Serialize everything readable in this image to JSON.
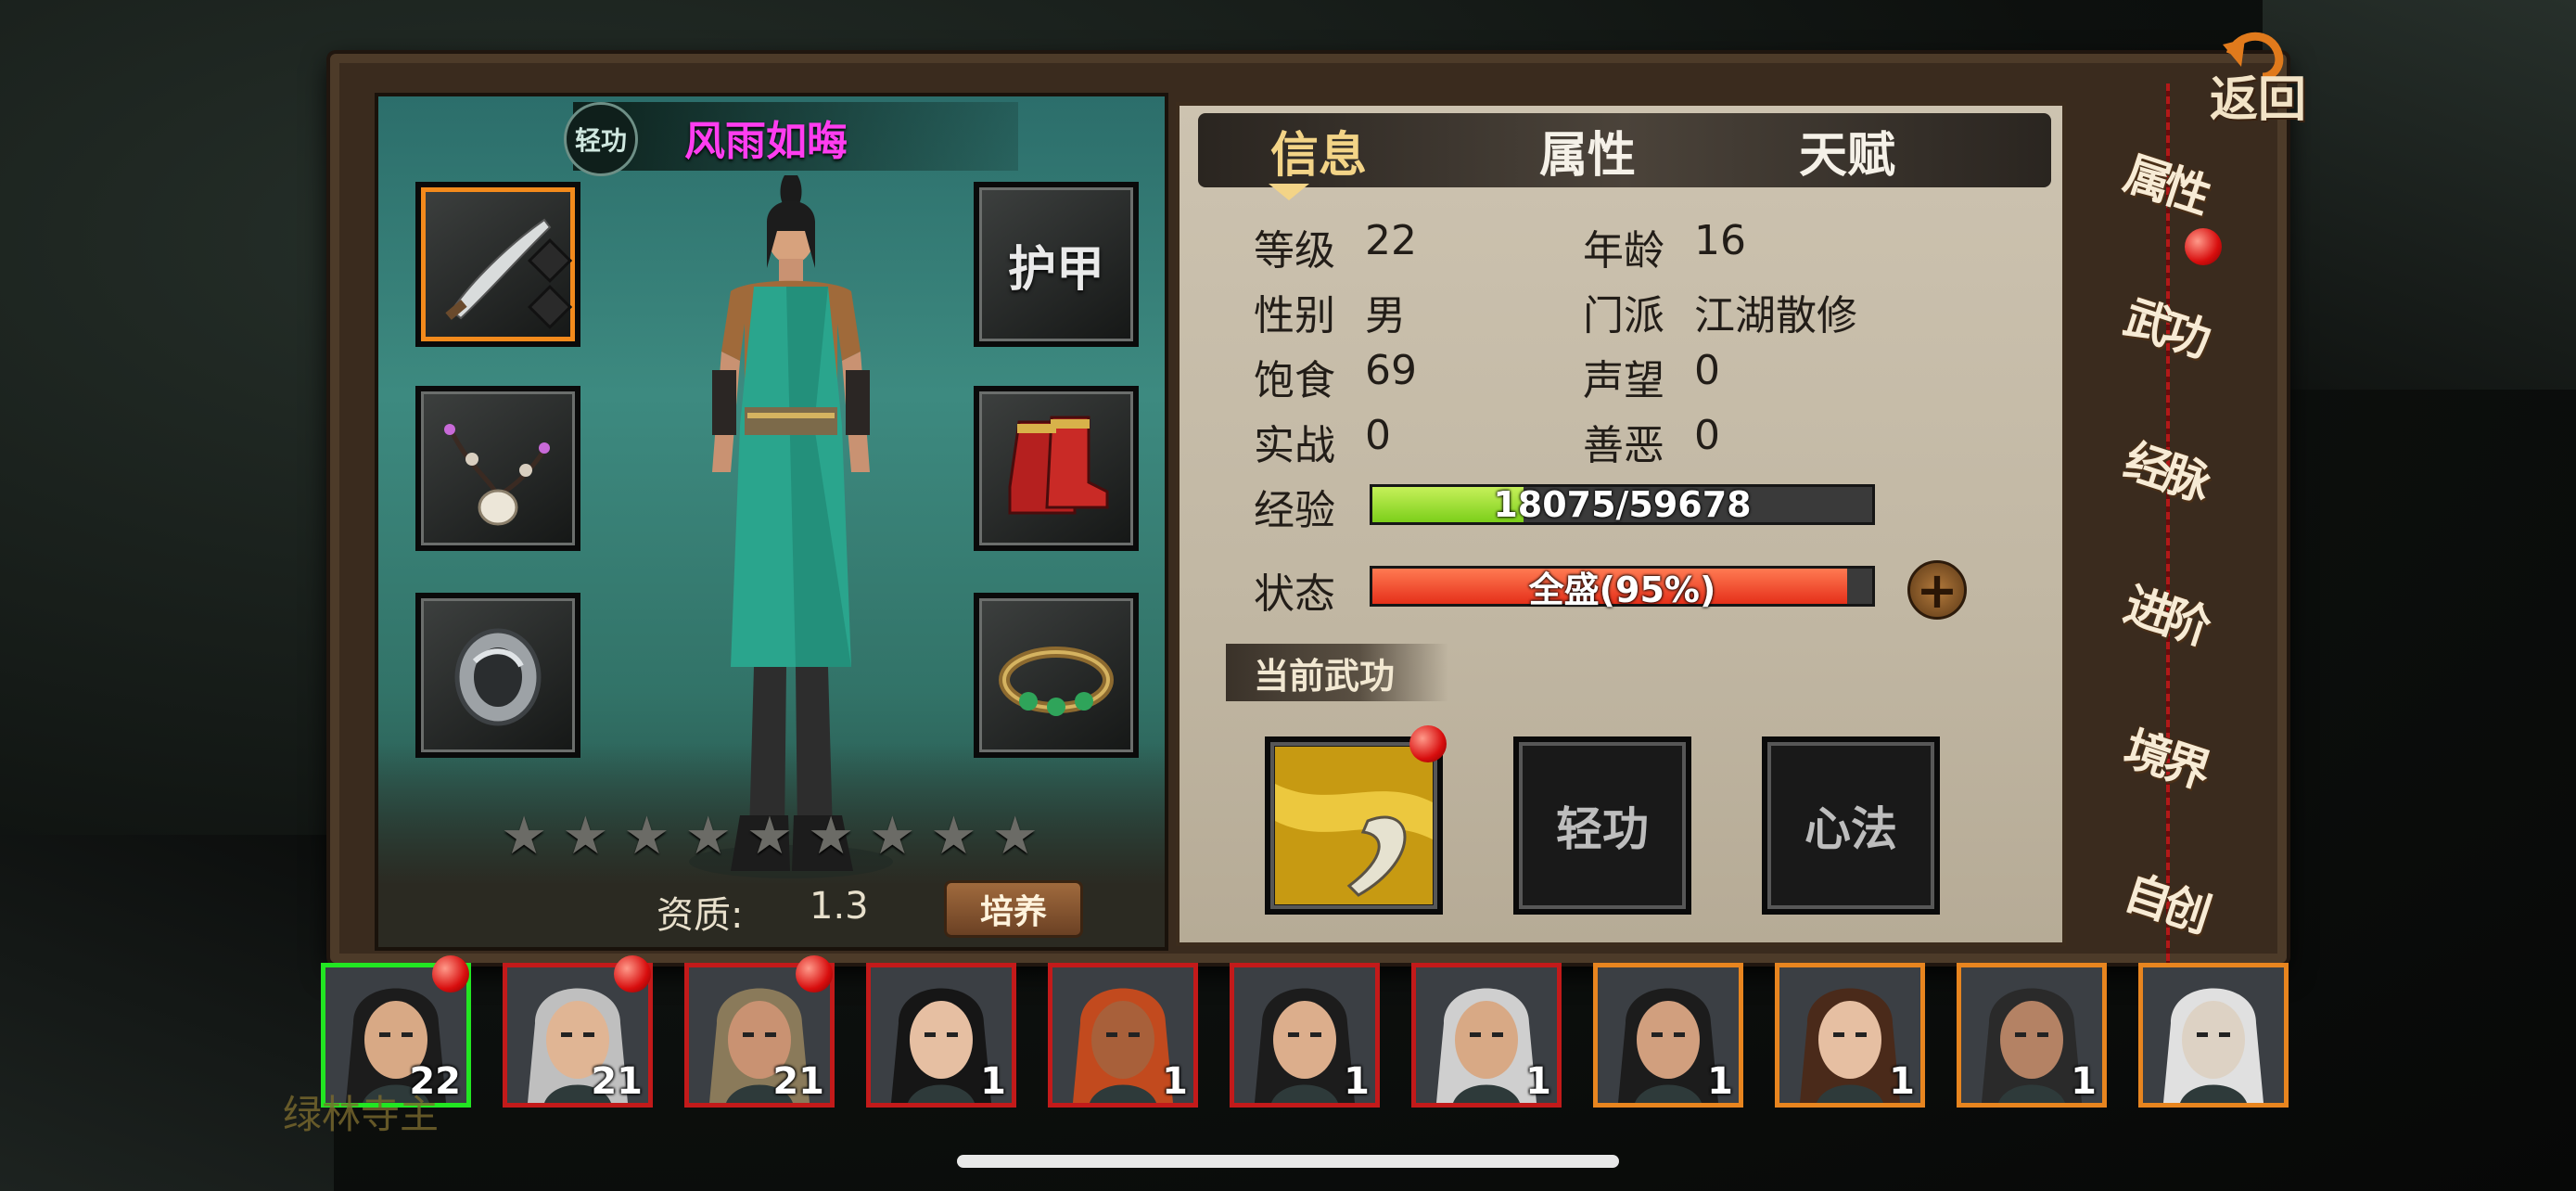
{
  "header": {
    "skill_badge": "轻功",
    "character_name": "风雨如晦"
  },
  "equipment": {
    "armor_label": "护甲",
    "weapon_icon": "saber-icon",
    "necklace_icon": "necklace-icon",
    "ring_icon": "ring-icon",
    "boots_icon": "boots-icon",
    "bracelet_icon": "bracelet-icon"
  },
  "stars": [
    "★",
    "★",
    "★",
    "★",
    "★",
    "★",
    "★",
    "★",
    "★"
  ],
  "aptitude": {
    "label": "资质:",
    "value": "1.3",
    "train_button": "培养"
  },
  "tabs": [
    {
      "label": "信息",
      "active": true
    },
    {
      "label": "属性",
      "active": false
    },
    {
      "label": "天赋",
      "active": false
    }
  ],
  "stats": {
    "level_key": "等级",
    "level_val": "22",
    "age_key": "年龄",
    "age_val": "16",
    "gender_key": "性别",
    "gender_val": "男",
    "sect_key": "门派",
    "sect_val": "江湖散修",
    "satiety_key": "饱食",
    "satiety_val": "69",
    "fame_key": "声望",
    "fame_val": "0",
    "combat_key": "实战",
    "combat_val": "0",
    "morality_key": "善恶",
    "morality_val": "0"
  },
  "experience": {
    "label": "经验",
    "text": "18075/59678",
    "current": 18075,
    "max": 59678
  },
  "status": {
    "label": "状态",
    "text": "全盛(95%)",
    "percent": 95
  },
  "current_skill": {
    "label": "当前武功",
    "slot2": "轻功",
    "slot3": "心法"
  },
  "side_menu": [
    "属性",
    "武功",
    "经脉",
    "进阶",
    "境界",
    "自创"
  ],
  "back_label": "返回",
  "roster": [
    {
      "level": "22",
      "border": "selected",
      "alert": true
    },
    {
      "level": "21",
      "border": "red",
      "alert": true
    },
    {
      "level": "21",
      "border": "red",
      "alert": true
    },
    {
      "level": "1",
      "border": "red",
      "alert": false
    },
    {
      "level": "1",
      "border": "red",
      "alert": false
    },
    {
      "level": "1",
      "border": "red",
      "alert": false
    },
    {
      "level": "1",
      "border": "red",
      "alert": false
    },
    {
      "level": "1",
      "border": "orange",
      "alert": false
    },
    {
      "level": "1",
      "border": "orange",
      "alert": false
    },
    {
      "level": "1",
      "border": "orange",
      "alert": false
    },
    {
      "level": "",
      "border": "orange",
      "alert": false
    }
  ],
  "ghost_text": "绿林寺主",
  "colors": {
    "name": "#ff3df0",
    "exp_fill": "#7ccf1a",
    "status_fill": "#e5301a",
    "active_tab": "#f3d487"
  }
}
